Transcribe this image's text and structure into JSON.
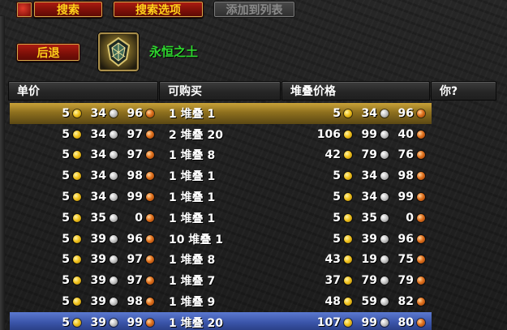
{
  "toolbar": {
    "search_label": "搜索",
    "search_options_label": "搜索选项",
    "add_to_list_label": "添加到列表"
  },
  "nav": {
    "back_label": "后退"
  },
  "item": {
    "icon": "eternal-earth-icon",
    "name": "永恒之土",
    "name_color": "#2ed62e"
  },
  "columns": {
    "unit_price": "单价",
    "available": "可购买",
    "stack_price": "堆叠价格",
    "yours": "你?"
  },
  "colors": {
    "highlight_row": "#c9a238",
    "selected_row": "#3a54a8",
    "gold": "#f1c31d",
    "silver": "#c8c8c8",
    "copper": "#e0701d"
  },
  "rows": [
    {
      "unit": [
        "5",
        "34",
        "96"
      ],
      "available": "1 堆叠 1",
      "stack": [
        "5",
        "34",
        "96"
      ],
      "state": "highlight"
    },
    {
      "unit": [
        "5",
        "34",
        "97"
      ],
      "available": "2 堆叠 20",
      "stack": [
        "106",
        "99",
        "40"
      ],
      "state": ""
    },
    {
      "unit": [
        "5",
        "34",
        "97"
      ],
      "available": "1 堆叠 8",
      "stack": [
        "42",
        "79",
        "76"
      ],
      "state": ""
    },
    {
      "unit": [
        "5",
        "34",
        "98"
      ],
      "available": "1 堆叠 1",
      "stack": [
        "5",
        "34",
        "98"
      ],
      "state": ""
    },
    {
      "unit": [
        "5",
        "34",
        "99"
      ],
      "available": "1 堆叠 1",
      "stack": [
        "5",
        "34",
        "99"
      ],
      "state": ""
    },
    {
      "unit": [
        "5",
        "35",
        "0"
      ],
      "available": "1 堆叠 1",
      "stack": [
        "5",
        "35",
        "0"
      ],
      "state": ""
    },
    {
      "unit": [
        "5",
        "39",
        "96"
      ],
      "available": "10 堆叠 1",
      "stack": [
        "5",
        "39",
        "96"
      ],
      "state": ""
    },
    {
      "unit": [
        "5",
        "39",
        "97"
      ],
      "available": "1 堆叠 8",
      "stack": [
        "43",
        "19",
        "75"
      ],
      "state": ""
    },
    {
      "unit": [
        "5",
        "39",
        "97"
      ],
      "available": "1 堆叠 7",
      "stack": [
        "37",
        "79",
        "79"
      ],
      "state": ""
    },
    {
      "unit": [
        "5",
        "39",
        "98"
      ],
      "available": "1 堆叠 9",
      "stack": [
        "48",
        "59",
        "82"
      ],
      "state": ""
    },
    {
      "unit": [
        "5",
        "39",
        "99"
      ],
      "available": "1 堆叠 20",
      "stack": [
        "107",
        "99",
        "80"
      ],
      "state": "selected"
    }
  ]
}
